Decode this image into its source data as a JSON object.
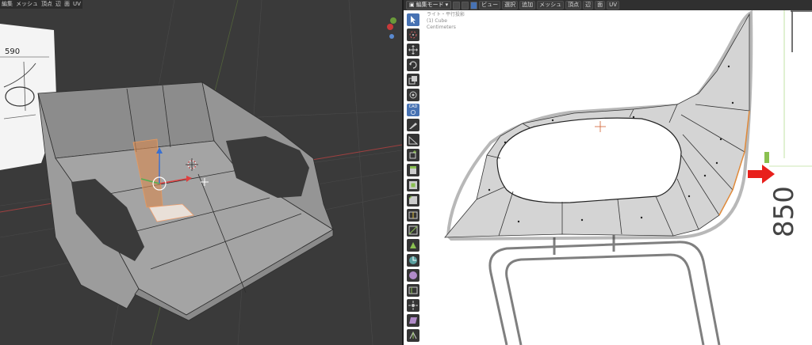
{
  "left_viewport": {
    "menu": [
      "編集",
      "メッシュ",
      "頂点",
      "辺",
      "面",
      "UV"
    ],
    "reference_dimension": "590"
  },
  "right_viewport": {
    "header": {
      "mode": "編集モード",
      "menus": [
        "ビュー",
        "選択",
        "追加",
        "メッシュ",
        "頂点",
        "辺",
        "面",
        "UV"
      ]
    },
    "overlay": {
      "view": "ライト・平行投影",
      "object": "(1) Cube",
      "units": "Centimeters"
    },
    "reference_dimension": "850",
    "toolbar": [
      {
        "icon": "select-box-icon"
      },
      {
        "icon": "cursor-icon"
      },
      {
        "icon": "move-icon"
      },
      {
        "icon": "rotate-icon"
      },
      {
        "icon": "scale-icon"
      },
      {
        "icon": "transform-icon"
      },
      {
        "icon": "cad-snap-icon",
        "label": "CAD"
      },
      {
        "icon": "annotate-icon"
      },
      {
        "icon": "measure-icon"
      },
      {
        "icon": "add-cube-icon"
      },
      {
        "icon": "extrude-icon"
      },
      {
        "icon": "inset-icon"
      },
      {
        "icon": "bevel-icon"
      },
      {
        "icon": "loop-cut-icon"
      },
      {
        "icon": "knife-icon"
      },
      {
        "icon": "poly-build-icon"
      },
      {
        "icon": "spin-icon"
      },
      {
        "icon": "smooth-icon"
      },
      {
        "icon": "edge-slide-icon"
      },
      {
        "icon": "shrink-fatten-icon"
      },
      {
        "icon": "shear-icon"
      },
      {
        "icon": "rip-icon"
      }
    ],
    "accent_color": "#4772b3",
    "pointer_color": "#e8201c"
  }
}
